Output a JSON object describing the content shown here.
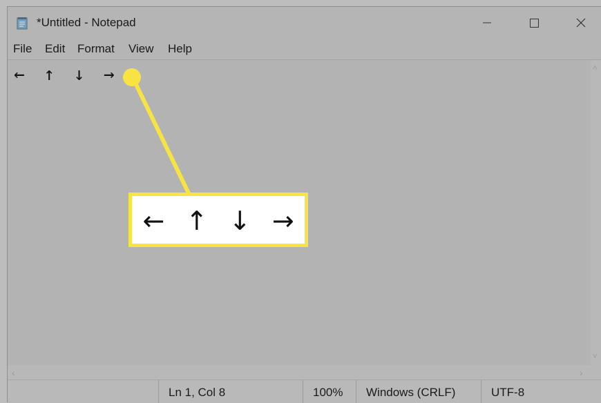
{
  "window": {
    "title": "*Untitled - Notepad",
    "controls": {
      "minimize_icon": "minimize-icon",
      "maximize_icon": "maximize-icon",
      "close_icon": "close-icon"
    }
  },
  "menu": {
    "items": [
      "File",
      "Edit",
      "Format",
      "View",
      "Help"
    ]
  },
  "editor": {
    "content": "← ↑ ↓ →"
  },
  "statusbar": {
    "position": "Ln 1, Col 8",
    "zoom": "100%",
    "line_endings": "Windows (CRLF)",
    "encoding": "UTF-8"
  },
  "callout": {
    "arrows": [
      "←",
      "↑",
      "↓",
      "→"
    ],
    "color": "#f7e443"
  }
}
